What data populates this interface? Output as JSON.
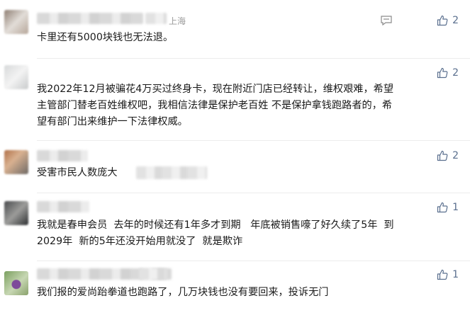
{
  "comments": [
    {
      "location": "上海",
      "text": "卡里还有5000块钱也无法退。",
      "likes": "2"
    },
    {
      "location": "",
      "text": "我2022年12月被骗花4万买过终身卡，现在附近门店已经转让，维权艰难，希望\n主管部门替老百姓维权吧，我相信法律是保护老百姓 不是保护拿钱跑路者的，希\n望有部门出来维护一下法律权威。",
      "likes": "2"
    },
    {
      "location": "",
      "text": "受害市民人数庞大",
      "likes": "2"
    },
    {
      "location": "",
      "text": "我就是春申会员  去年的时候还有1年多才到期   年底被销售嚎了好久续了5年  到\n2029年  新的5年还没开始用就没了  就是欺诈",
      "likes": "1"
    },
    {
      "location": "",
      "text": "我们报的爱尚跆拳道也跑路了，几万块钱也没有要回来，投诉无门",
      "likes": "1"
    }
  ],
  "icons": {
    "reply": "reply-icon",
    "like": "thumbs-up-icon"
  },
  "colors": {
    "like": "#5a6f8e",
    "location": "#9a9a9a",
    "text": "#1a1a1a"
  }
}
